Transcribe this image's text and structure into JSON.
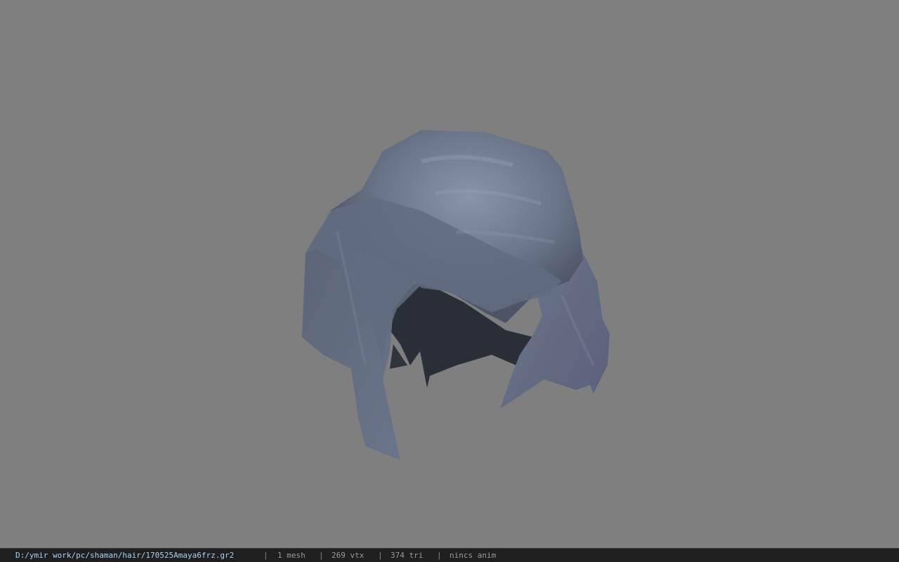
{
  "viewer": {
    "background_color": "#7f7f7f",
    "model_color": "#5f6a80",
    "model_shadow_color": "#2a2e36",
    "model_icon": "hair-mesh-icon"
  },
  "status_bar": {
    "file_path": "D:/ymir work/pc/shaman/hair/170525Amaya6frz.gr2",
    "separator": "|",
    "mesh_count": "1 mesh",
    "vertex_count": "269 vtx",
    "triangle_count": "374 tri",
    "anim_status": "nincs anim"
  }
}
